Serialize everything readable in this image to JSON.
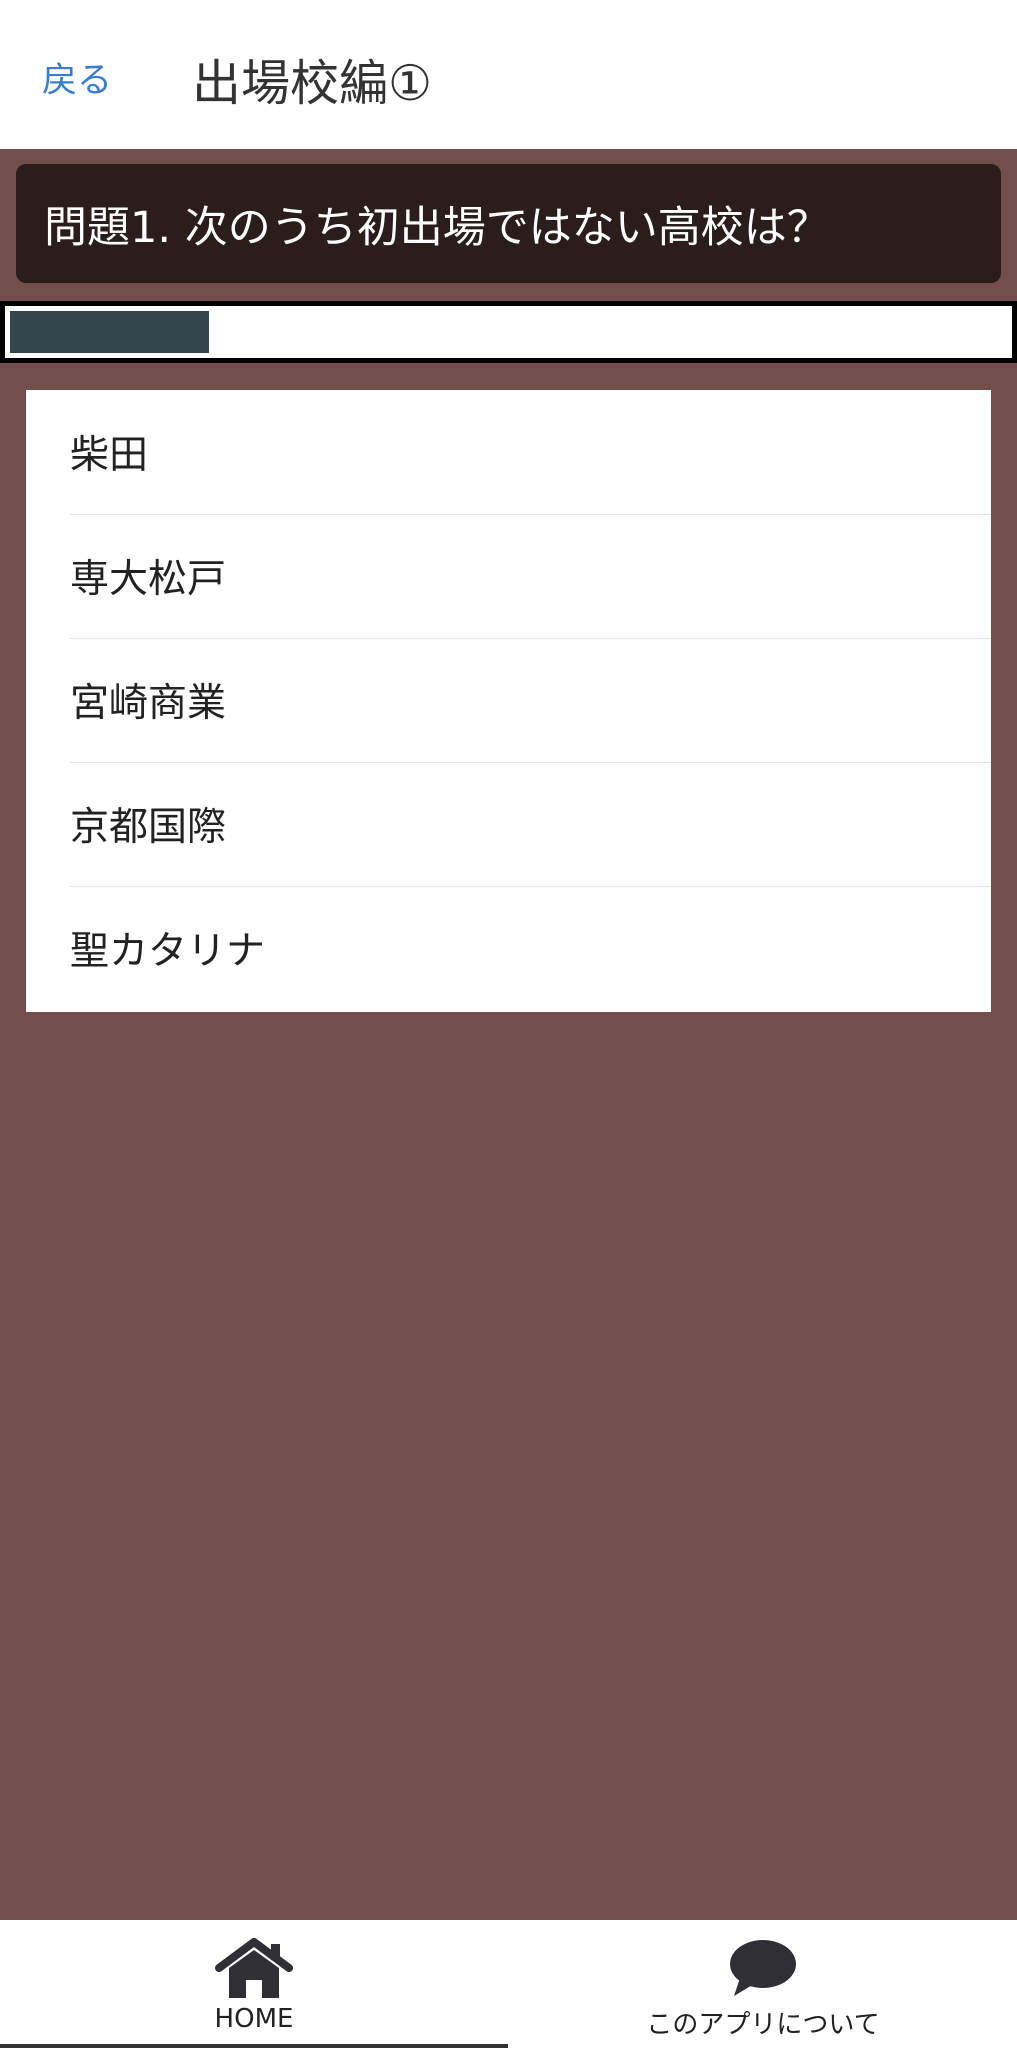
{
  "header": {
    "back_label": "戻る",
    "title": "出場校編①"
  },
  "question": {
    "text": "問題1. 次のうち初出場ではない高校は？"
  },
  "progress": {
    "fraction": 0.2
  },
  "choices": [
    {
      "label": "柴田"
    },
    {
      "label": "専大松戸"
    },
    {
      "label": "宮崎商業"
    },
    {
      "label": "京都国際"
    },
    {
      "label": "聖カタリナ"
    }
  ],
  "tabs": {
    "home_label": "HOME",
    "home_icon": "home-icon",
    "about_label": "このアプリについて",
    "about_icon": "chat-bubble-icon",
    "active": "home"
  },
  "colors": {
    "background": "#734f4b",
    "question_bg": "#2b1d1c",
    "progress_fill": "#34464b",
    "link": "#3a7bd5"
  }
}
